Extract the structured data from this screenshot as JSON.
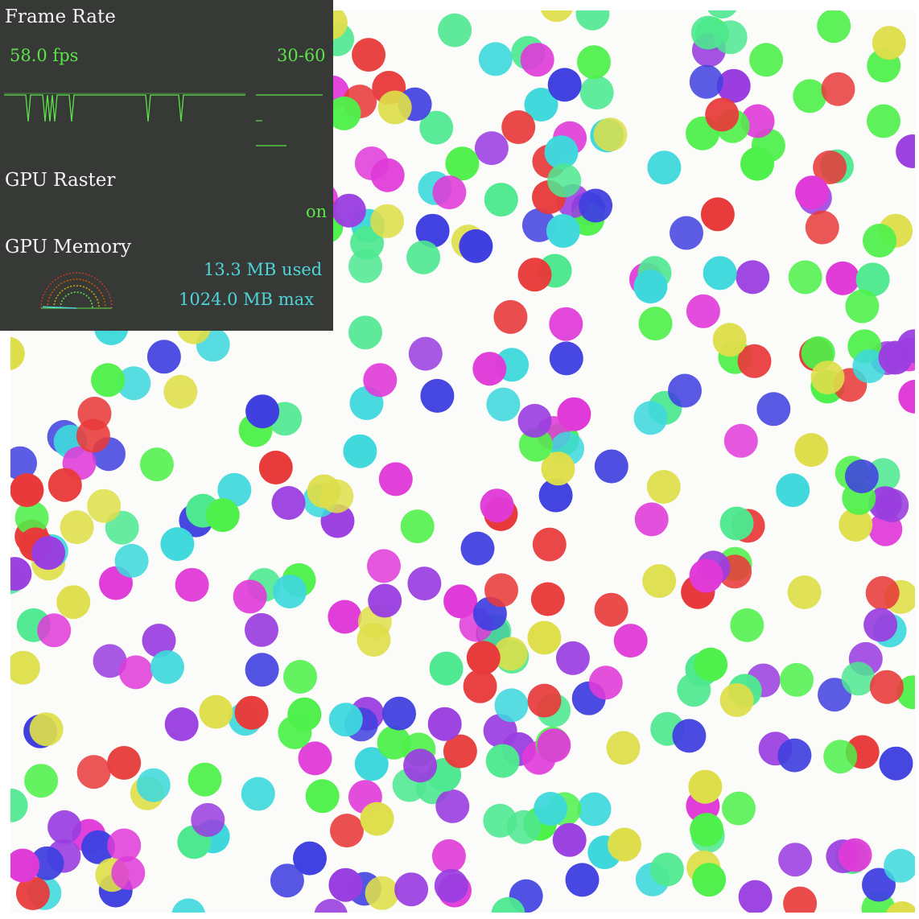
{
  "hud": {
    "frame_rate": {
      "title": "Frame Rate",
      "fps": "58.0 fps",
      "range": "30-60"
    },
    "gpu_raster": {
      "title": "GPU Raster",
      "status": "on"
    },
    "gpu_memory": {
      "title": "GPU Memory",
      "used": "13.3 MB used",
      "max": "1024.0 MB max",
      "fraction_used": 0.013
    }
  },
  "colors": {
    "background": "#fbfbfa",
    "hud_background": "#363936",
    "hud_green": "#5de34a",
    "hud_cyan": "#4fd4d8",
    "ball_palette": [
      "#e83a3a",
      "#4040e0",
      "#4ef04a",
      "#e03ad8",
      "#dede4a",
      "#3ed8dc",
      "#9a3ee0",
      "#4ee890"
    ]
  },
  "scene": {
    "content": "animated field of overlapping colored circles",
    "ball_count_estimate": 420
  }
}
